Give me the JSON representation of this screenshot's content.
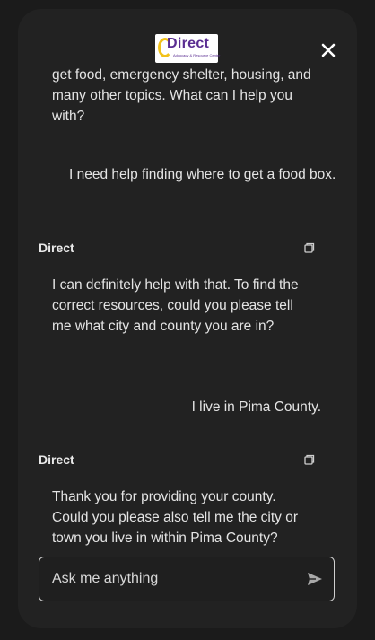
{
  "header": {
    "logo_text": "Direct",
    "logo_subtext": "Advocacy & Resource Center",
    "close_icon": "close-icon"
  },
  "messages": [
    {
      "role": "assistant",
      "text": "get food, emergency shelter, housing, and many other topics. What can I help you with?"
    },
    {
      "role": "user",
      "text": "I need help finding where to get a food box."
    },
    {
      "role": "assistant",
      "sender": "Direct",
      "text": "I can definitely help with that. To find the correct resources, could you please tell me what city and county you are in?"
    },
    {
      "role": "user",
      "text": "I live in Pima County."
    },
    {
      "role": "assistant",
      "sender": "Direct",
      "text": "Thank you for providing your county. Could you please also tell me the city or town you live in within Pima County?"
    }
  ],
  "composer": {
    "placeholder": "Ask me anything",
    "value": "",
    "send_icon": "send-icon"
  },
  "colors": {
    "background": "#1b1b1b",
    "panel": "#222222",
    "text": "#e4e4e4",
    "logo_purple": "#5a2d91",
    "logo_yellow": "#f2c21b"
  }
}
